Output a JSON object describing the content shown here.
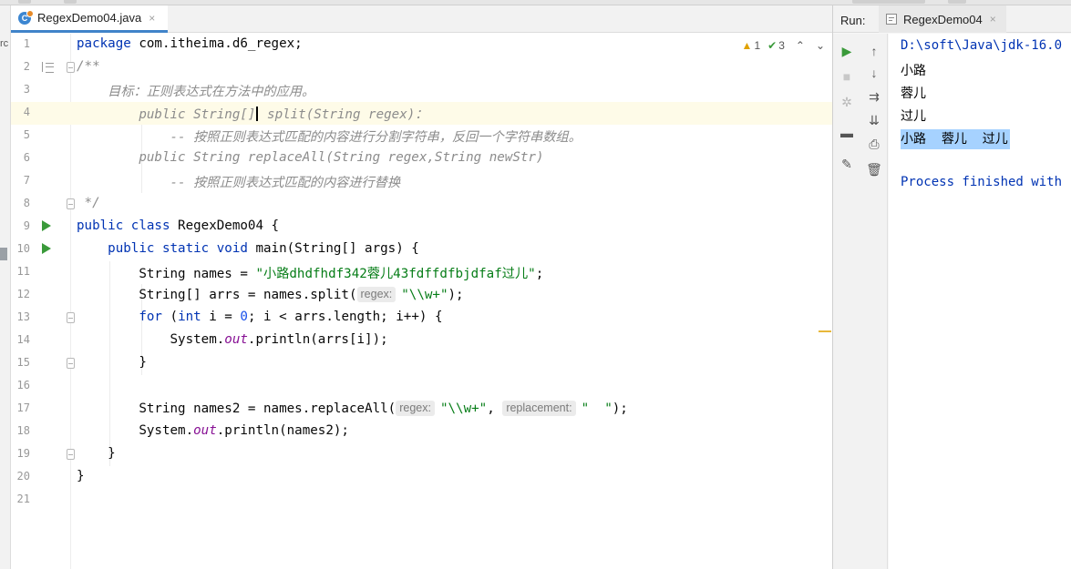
{
  "editor": {
    "tab": {
      "filename": "RegexDemo04.java",
      "close": "×"
    },
    "left_fragment": "rc",
    "inspection": {
      "warnings": "1",
      "weak_warnings": "3",
      "warn_icon": "warning-triangle-icon",
      "ok_icon": "double-check-icon"
    },
    "lines": [
      {
        "n": "1"
      },
      {
        "n": "2"
      },
      {
        "n": "3"
      },
      {
        "n": "4"
      },
      {
        "n": "5"
      },
      {
        "n": "6"
      },
      {
        "n": "7"
      },
      {
        "n": "8"
      },
      {
        "n": "9"
      },
      {
        "n": "10"
      },
      {
        "n": "11"
      },
      {
        "n": "12"
      },
      {
        "n": "13"
      },
      {
        "n": "14"
      },
      {
        "n": "15"
      },
      {
        "n": "16"
      },
      {
        "n": "17"
      },
      {
        "n": "18"
      },
      {
        "n": "19"
      },
      {
        "n": "20"
      },
      {
        "n": "21"
      }
    ],
    "code": {
      "l1_kw": "package",
      "l1_rest": " com.itheima.d6_regex;",
      "l2": "/**",
      "l3": "    目标：正则表达式在方法中的应用。",
      "l4_a": "        public String[]",
      "l4_b": " s",
      "l4_c": "plit(String regex)：",
      "l5": "            -- 按照正则表达式匹配的内容进行分割字符串，反回一个字符串数组。",
      "l6": "        public String replaceAll(String regex,String newStr)",
      "l7": "            -- 按照正则表达式匹配的内容进行替换",
      "l8": " */",
      "l9_kw": "public class",
      "l9_rest": " RegexDemo04 {",
      "l10_indent": "    ",
      "l10_kw": "public static void",
      "l10_rest": " main(String[] args) {",
      "l11_a": "        String names = ",
      "l11_str": "\"小路dhdfhdf342蓉儿43fdffdfbjdfaf过儿\"",
      "l11_b": ";",
      "l12_a": "        String[] arrs = names.split(",
      "l12_hint": "regex:",
      "l12_str": "\"\\\\w+\"",
      "l12_b": ");",
      "l13_indent": "        ",
      "l13_kw": "for",
      "l13_a": " (",
      "l13_kw2": "int",
      "l13_b": " i = ",
      "l13_num": "0",
      "l13_c": "; i < arrs.length; i++) {",
      "l14_a": "            System.",
      "l14_out": "out",
      "l14_b": ".println(arrs[i]);",
      "l15": "        }",
      "l17_a": "        String names2 = names.replaceAll(",
      "l17_hint1": "regex:",
      "l17_str1": "\"\\\\w+\"",
      "l17_b": ", ",
      "l17_hint2": "replacement:",
      "l17_str2": "\"  \"",
      "l17_c": ");",
      "l18_a": "        System.",
      "l18_out": "out",
      "l18_b": ".println(names2);",
      "l19": "    }",
      "l20": "}"
    }
  },
  "run": {
    "title": "Run:",
    "tab": "RegexDemo04",
    "tab_close": "×",
    "toolbar_icons": [
      "run-icon",
      "up-icon",
      "stop-icon",
      "down-icon",
      "debug-icon",
      "soft-wrap-icon",
      "layout-icon",
      "scroll-to-end-icon",
      "pin-icon",
      "print-icon",
      "trash-icon"
    ],
    "console": {
      "cmd": "D:\\soft\\Java\\jdk-16.0",
      "out1": "小路",
      "out2": "蓉儿",
      "out3": "过儿",
      "out4": "小路  蓉儿  过儿",
      "finish": "Process finished with"
    }
  },
  "colors": {
    "accent": "#4083c9",
    "keyword": "#0033b3",
    "string": "#067d17",
    "comment": "#8c8c8c",
    "selection": "#a6d2ff",
    "run_green": "#3a9a3a",
    "current_line": "#fefbe8"
  }
}
